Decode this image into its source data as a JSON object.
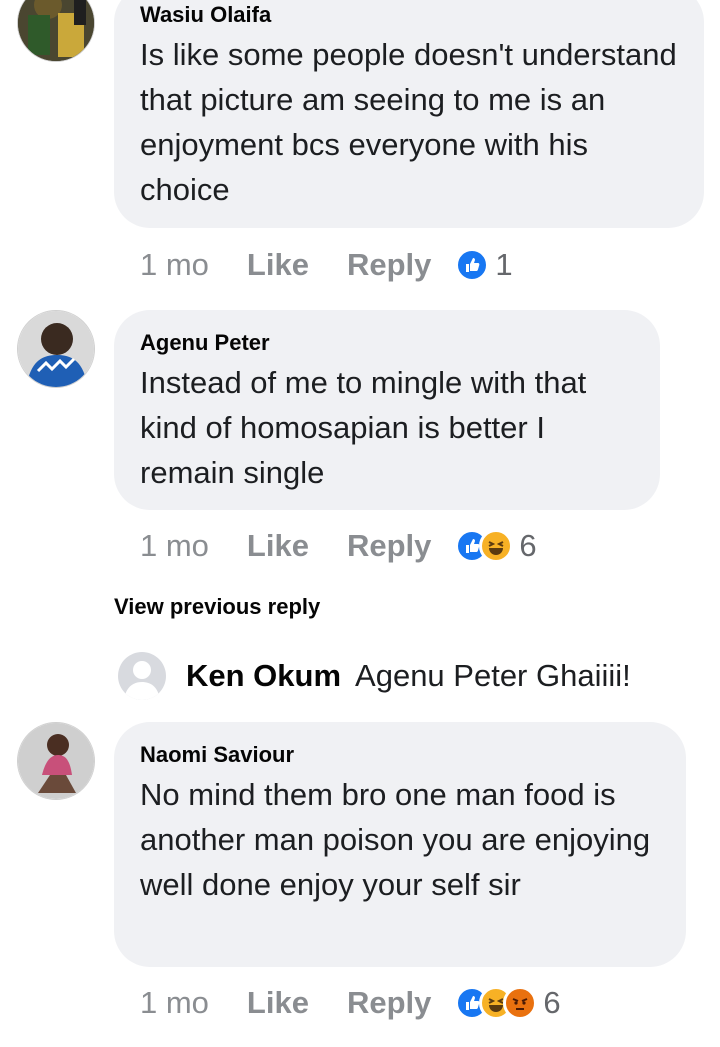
{
  "comments": [
    {
      "author": "Wasiu Olaifa",
      "text": "Is like some people doesn't understand that picture am seeing to me is an enjoyment bcs everyone with his choice",
      "time": "1 mo",
      "like_label": "Like",
      "reply_label": "Reply",
      "reactions": [
        "like-icon"
      ],
      "reaction_count": "1"
    },
    {
      "author": "Agenu Peter",
      "text": "Instead of me to mingle with that kind of homosapian is better I remain single",
      "time": "1 mo",
      "like_label": "Like",
      "reply_label": "Reply",
      "reactions": [
        "like-icon",
        "haha-icon"
      ],
      "reaction_count": "6"
    },
    {
      "author": "Naomi Saviour",
      "text": "No mind them bro one man food is another man poison you are enjoying well done enjoy your self sir",
      "time": "1 mo",
      "like_label": "Like",
      "reply_label": "Reply",
      "reactions": [
        "like-icon",
        "haha-icon",
        "angry-icon"
      ],
      "reaction_count": "6"
    }
  ],
  "view_previous_reply": "View previous reply",
  "collapsed_reply": {
    "author": "Ken Okum",
    "text": "Agenu Peter Ghaiiii!"
  },
  "colors": {
    "bubble": "#f0f1f4",
    "meta_text": "#65676b",
    "like_blue": "#1877f2",
    "haha_yellow": "#f7b125",
    "angry_orange": "#e9710f"
  }
}
